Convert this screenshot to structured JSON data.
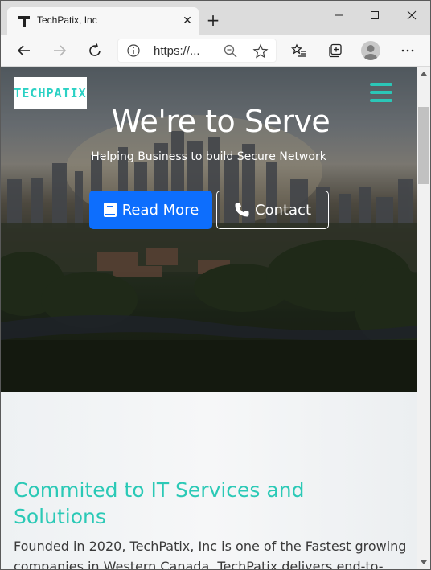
{
  "browser": {
    "tab_title": "TechPatix, Inc",
    "url": "https://...",
    "new_tab_glyph": "+",
    "close_glyph": "✕"
  },
  "site": {
    "logo_text": "TECHPATIX",
    "hero": {
      "title": "We're to Serve",
      "subtitle": "Helping Business to build Secure Network",
      "read_more_label": "Read More",
      "contact_label": "Contact"
    },
    "about": {
      "title": "Commited to IT Services and Solutions",
      "text": "Founded in 2020, TechPatix, Inc is one of the Fastest growing companies in Western Canada. TechPatix delivers end-to-"
    }
  },
  "colors": {
    "accent_teal": "#2bc9b6",
    "primary_button": "#0d6efd"
  },
  "icons": {
    "back": "back-arrow-icon",
    "forward": "forward-arrow-icon",
    "refresh": "refresh-icon",
    "info": "info-icon",
    "zoom": "zoom-out-icon",
    "favorite": "star-icon",
    "favorites_list": "favorites-icon",
    "collections": "collections-icon",
    "profile": "profile-icon",
    "menu": "more-icon",
    "book": "book-icon",
    "phone": "phone-icon",
    "hamburger": "hamburger-menu-icon"
  }
}
